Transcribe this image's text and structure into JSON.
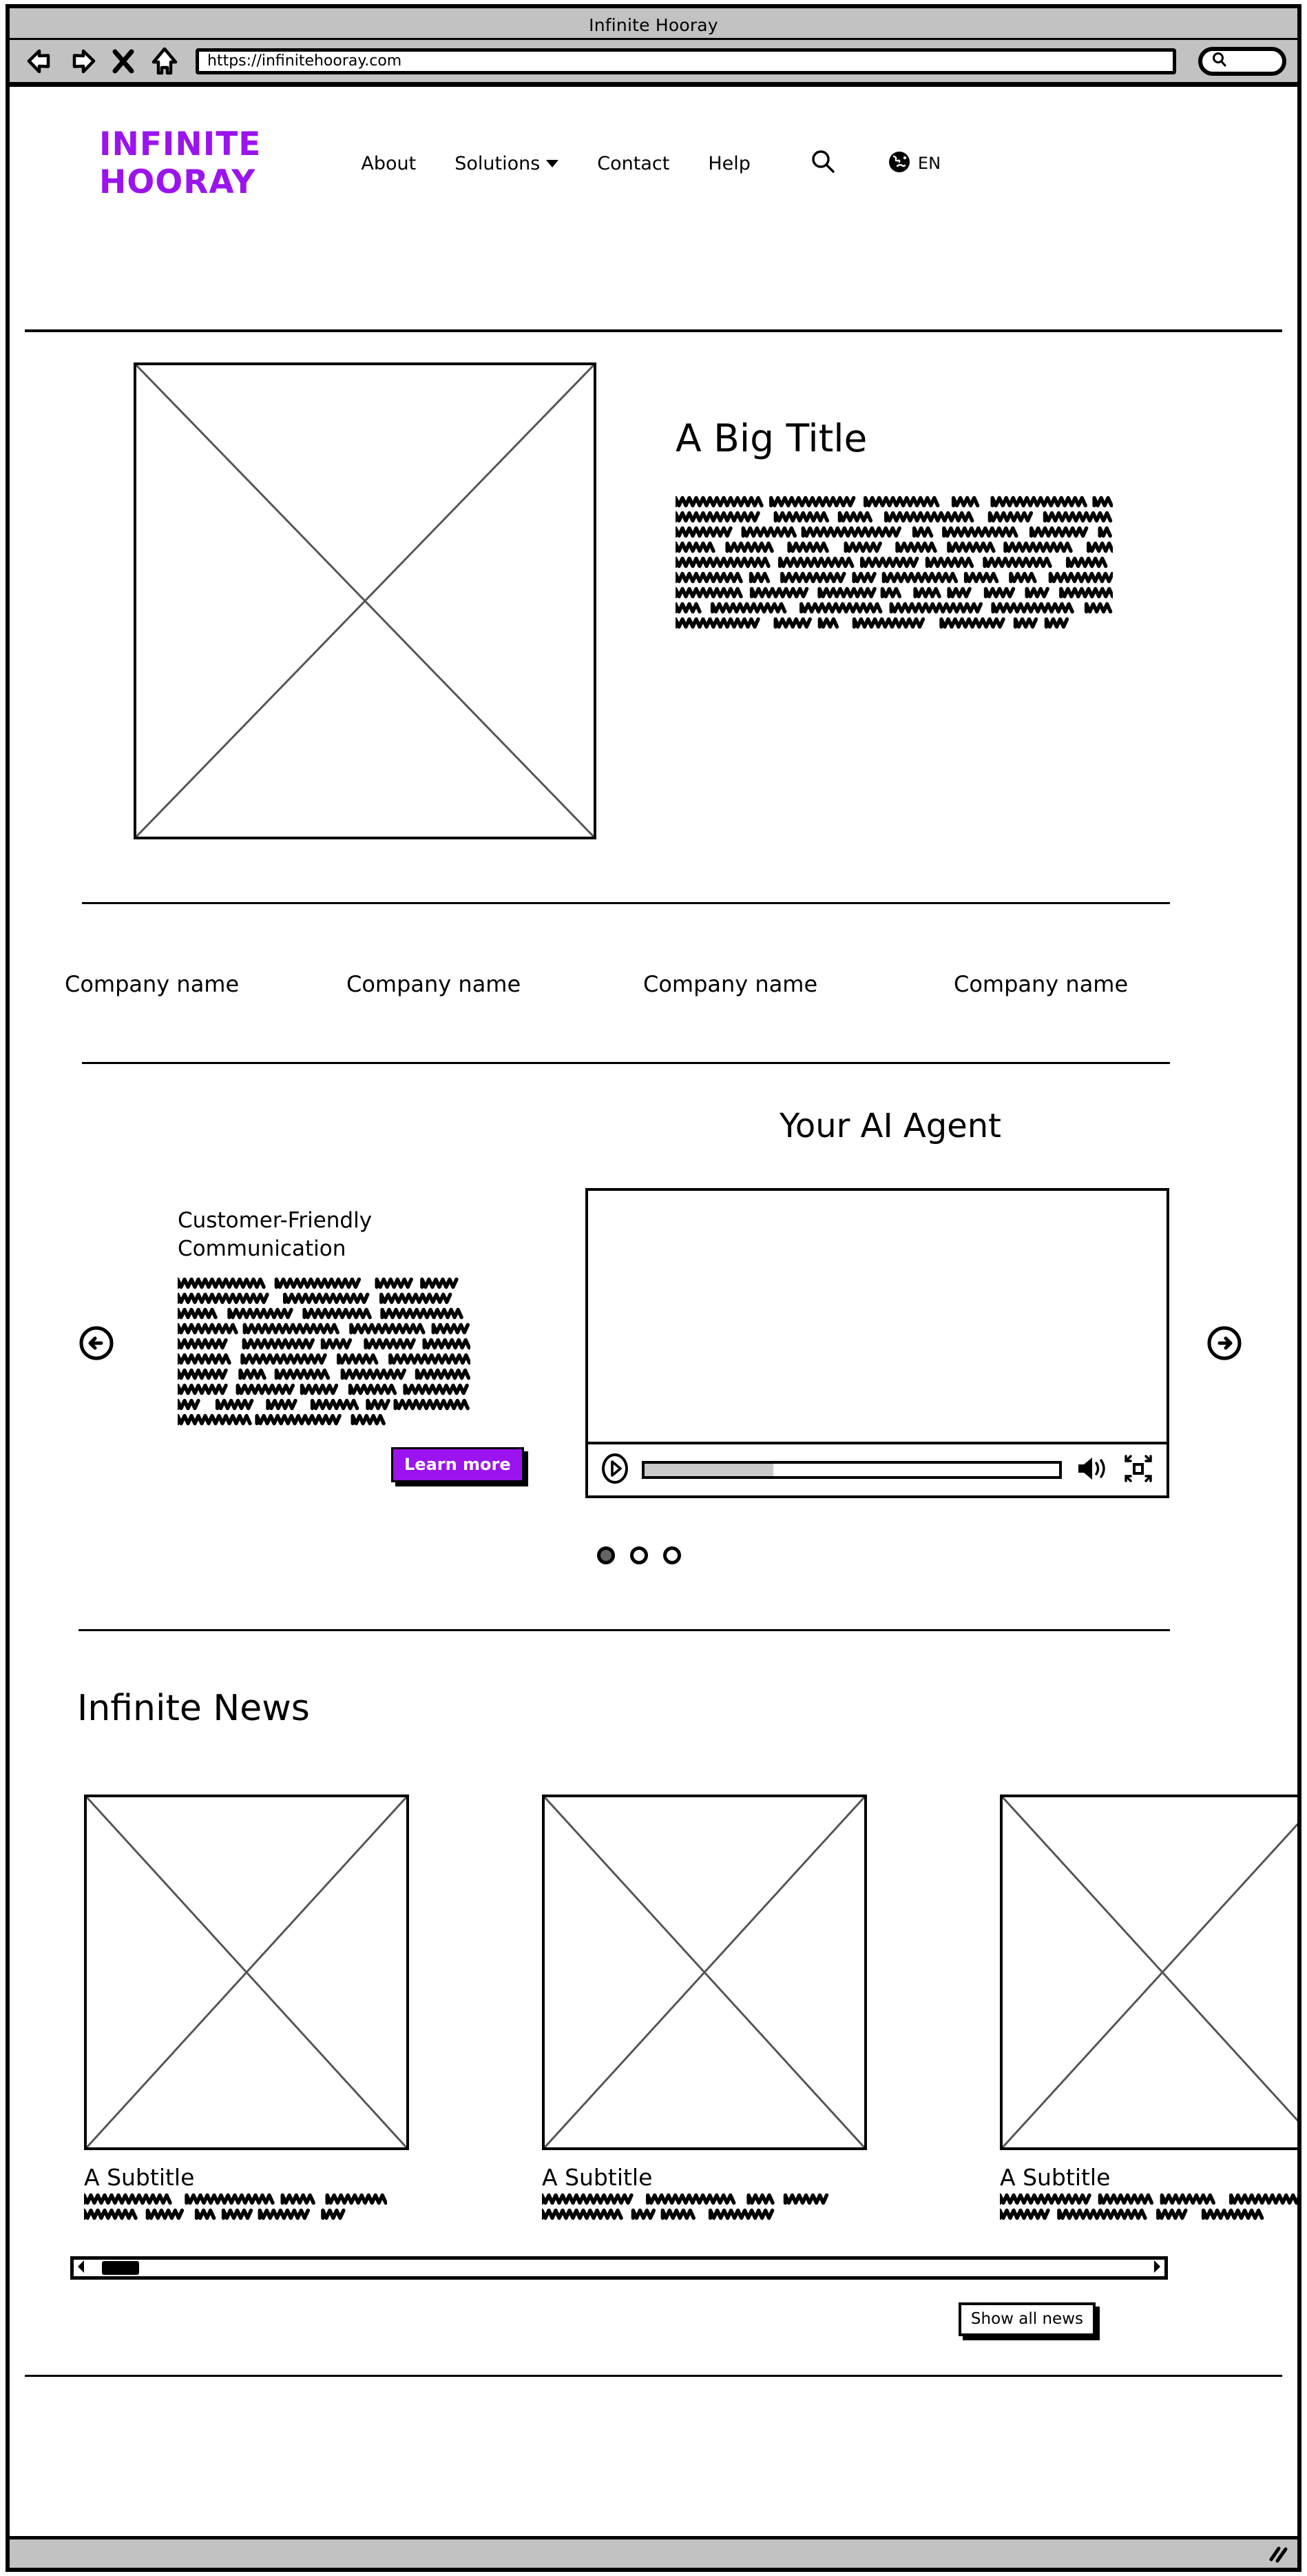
{
  "browser": {
    "title": "Infinite Hooray",
    "url": "https://infinitehooray.com",
    "back_icon": "back-arrow-icon",
    "forward_icon": "forward-arrow-icon",
    "stop_icon": "close-x-icon",
    "home_icon": "home-icon",
    "search_placeholder": ""
  },
  "header": {
    "logo": "INFINITE\nHOORAY",
    "logo_color": "#9b13ee",
    "nav": [
      {
        "label": "About",
        "has_dropdown": false
      },
      {
        "label": "Solutions",
        "has_dropdown": true
      },
      {
        "label": "Contact",
        "has_dropdown": false
      },
      {
        "label": "Help",
        "has_dropdown": false
      }
    ],
    "search_icon": "search-icon",
    "language_icon": "globe-icon",
    "language": "EN"
  },
  "hero": {
    "image_alt": "placeholder-image",
    "title": "A Big Title",
    "body_lines": 9
  },
  "clients": [
    {
      "name": "Company name"
    },
    {
      "name": "Company name"
    },
    {
      "name": "Company name"
    },
    {
      "name": "Company name"
    }
  ],
  "agent": {
    "title": "Your AI Agent",
    "prev_icon": "circle-arrow-left-icon",
    "next_icon": "circle-arrow-right-icon",
    "slide": {
      "title": "Customer-Friendly\nCommunication",
      "body_lines": 10,
      "cta_label": "Learn more",
      "cta_color": "#9b13ee"
    },
    "video": {
      "play_icon": "play-icon",
      "volume_icon": "volume-icon",
      "fullscreen_icon": "fullscreen-icon",
      "progress_percent": 31
    },
    "dots": [
      {
        "active": true
      },
      {
        "active": false
      },
      {
        "active": false
      }
    ]
  },
  "news": {
    "title": "Infinite News",
    "cards": [
      {
        "image_alt": "placeholder-image",
        "subtitle": "A Subtitle",
        "body_lines": 2
      },
      {
        "image_alt": "placeholder-image",
        "subtitle": "A Subtitle",
        "body_lines": 2
      },
      {
        "image_alt": "placeholder-image",
        "subtitle": "A Subtitle",
        "body_lines": 2
      }
    ],
    "scrollbar": {
      "thumb_percent": 4
    },
    "show_all_label": "Show all news"
  },
  "statusbar": {
    "resize_icon": "resize-grip-icon"
  }
}
